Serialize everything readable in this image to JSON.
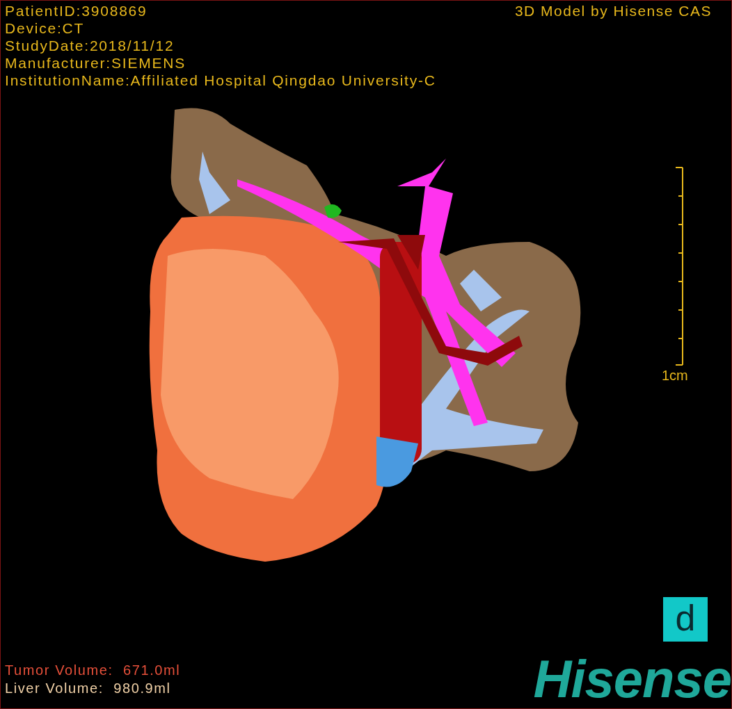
{
  "info_lines": [
    "PatientID:3908869",
    "Device:CT",
    "StudyDate:2018/11/12",
    "Manufacturer:SIEMENS",
    "InstitutionName:Affiliated Hospital Qingdao University-C"
  ],
  "title": "3D Model by Hisense CAS",
  "scale": {
    "label": "1cm"
  },
  "volumes": [
    {
      "kind": "tumor",
      "label": "Tumor Volume:",
      "value": "671.0ml"
    },
    {
      "kind": "liver",
      "label": "Liver Volume:",
      "value": "980.9ml"
    }
  ],
  "logo": {
    "badge": "d",
    "brand": "Hisense"
  }
}
